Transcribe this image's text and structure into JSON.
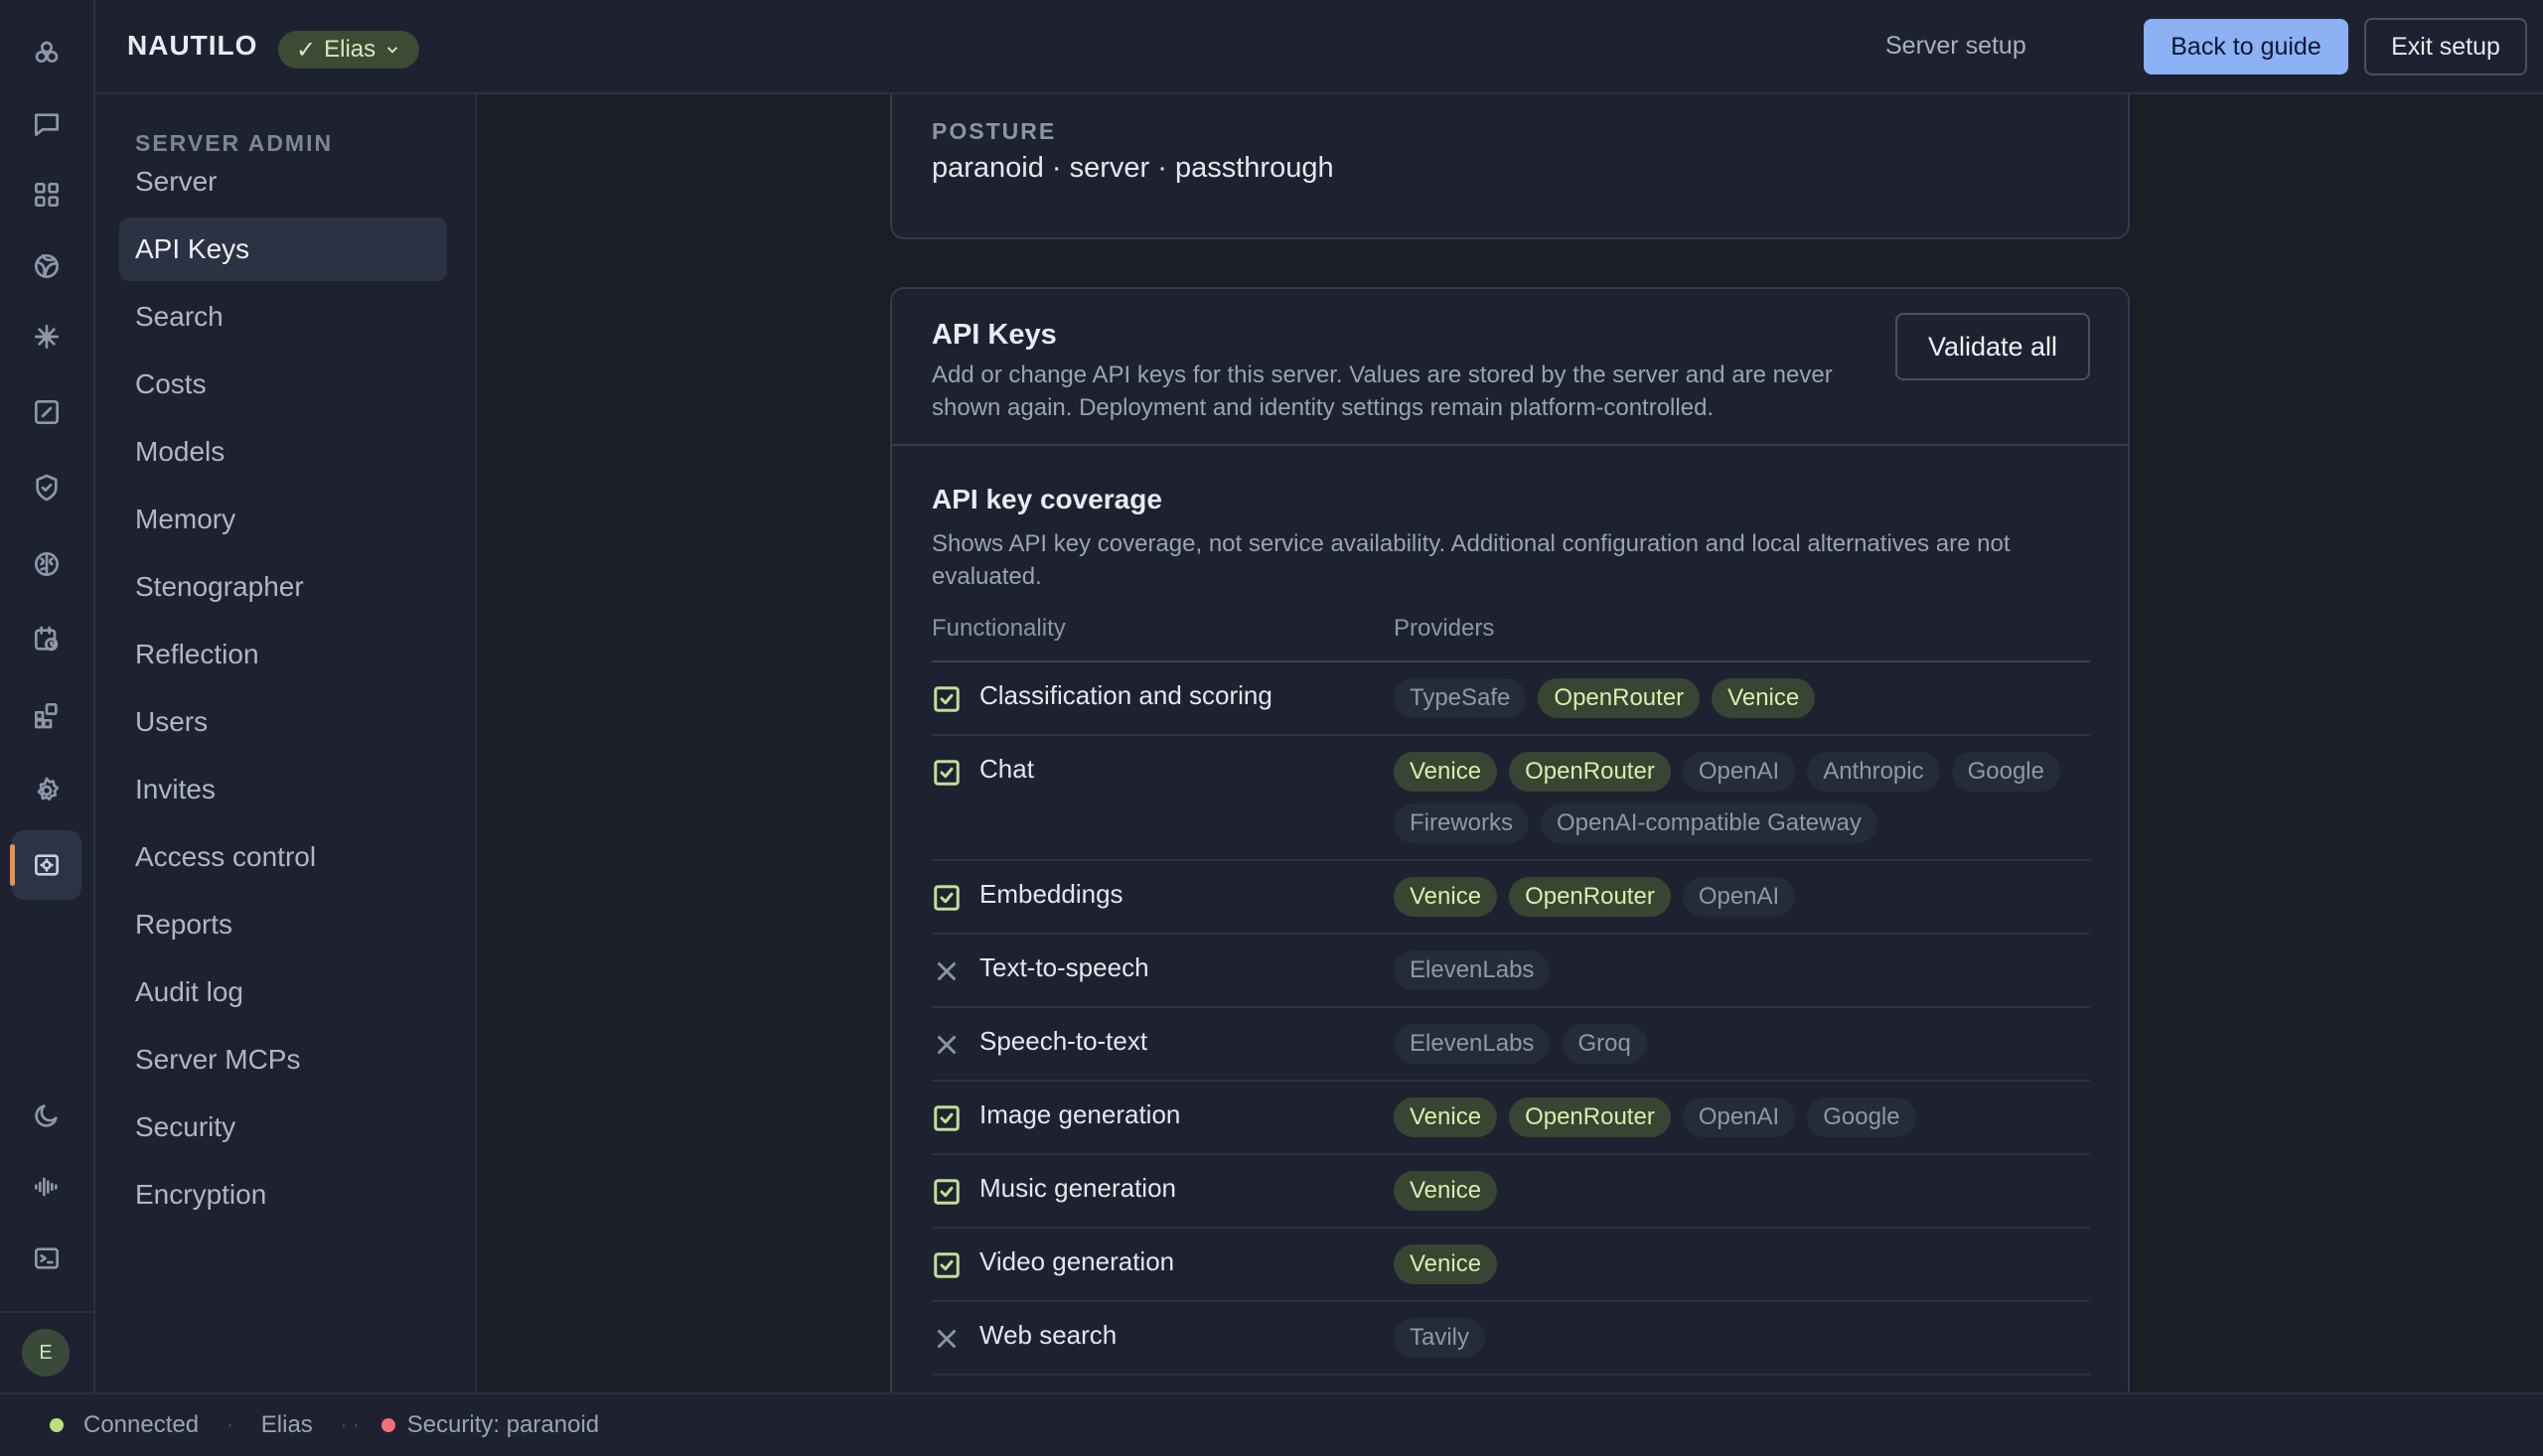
{
  "topbar": {
    "brand": "NAUTILO",
    "user": "Elias",
    "server_setup": "Server setup",
    "back_to_guide": "Back to guide",
    "exit_setup": "Exit setup"
  },
  "rail": {
    "icons": [
      "logo-icon",
      "chat-icon",
      "grid-icon",
      "globe-icon",
      "sparkle-icon",
      "edit-icon",
      "shield-icon",
      "brain-icon",
      "calendar-clock-icon",
      "apps-icon",
      "gear-icon",
      "server-admin-icon",
      "moon-icon",
      "audio-wave-icon",
      "terminal-icon"
    ],
    "avatar_initial": "E"
  },
  "sidebar": {
    "heading": "SERVER ADMIN",
    "items": [
      "Server",
      "API Keys",
      "Search",
      "Costs",
      "Models",
      "Memory",
      "Stenographer",
      "Reflection",
      "Users",
      "Invites",
      "Access control",
      "Reports",
      "Audit log",
      "Server MCPs",
      "Security",
      "Encryption"
    ],
    "active": "API Keys"
  },
  "posture": {
    "label": "POSTURE",
    "value": "paranoid · server · passthrough"
  },
  "api_keys": {
    "title": "API Keys",
    "description": "Add or change API keys for this server. Values are stored by the server and are never shown again. Deployment and identity settings remain platform-controlled.",
    "validate_all": "Validate all",
    "coverage_title": "API key coverage",
    "coverage_description": "Shows API key coverage, not service availability. Additional configuration and local alternatives are not evaluated.",
    "col_functionality": "Functionality",
    "col_providers": "Providers",
    "rows": [
      {
        "name": "Classification and scoring",
        "covered": true,
        "providers": [
          {
            "name": "TypeSafe",
            "on": false
          },
          {
            "name": "OpenRouter",
            "on": true
          },
          {
            "name": "Venice",
            "on": true
          }
        ]
      },
      {
        "name": "Chat",
        "covered": true,
        "providers": [
          {
            "name": "Venice",
            "on": true
          },
          {
            "name": "OpenRouter",
            "on": true
          },
          {
            "name": "OpenAI",
            "on": false
          },
          {
            "name": "Anthropic",
            "on": false
          },
          {
            "name": "Google",
            "on": false
          },
          {
            "name": "Fireworks",
            "on": false
          },
          {
            "name": "OpenAI-compatible Gateway",
            "on": false
          }
        ]
      },
      {
        "name": "Embeddings",
        "covered": true,
        "providers": [
          {
            "name": "Venice",
            "on": true
          },
          {
            "name": "OpenRouter",
            "on": true
          },
          {
            "name": "OpenAI",
            "on": false
          }
        ]
      },
      {
        "name": "Text-to-speech",
        "covered": false,
        "providers": [
          {
            "name": "ElevenLabs",
            "on": false
          }
        ]
      },
      {
        "name": "Speech-to-text",
        "covered": false,
        "providers": [
          {
            "name": "ElevenLabs",
            "on": false
          },
          {
            "name": "Groq",
            "on": false
          }
        ]
      },
      {
        "name": "Image generation",
        "covered": true,
        "providers": [
          {
            "name": "Venice",
            "on": true
          },
          {
            "name": "OpenRouter",
            "on": true
          },
          {
            "name": "OpenAI",
            "on": false
          },
          {
            "name": "Google",
            "on": false
          }
        ]
      },
      {
        "name": "Music generation",
        "covered": true,
        "providers": [
          {
            "name": "Venice",
            "on": true
          }
        ]
      },
      {
        "name": "Video generation",
        "covered": true,
        "providers": [
          {
            "name": "Venice",
            "on": true
          }
        ]
      },
      {
        "name": "Web search",
        "covered": false,
        "providers": [
          {
            "name": "Tavily",
            "on": false
          }
        ]
      }
    ]
  },
  "statusbar": {
    "connected": "Connected",
    "user": "Elias",
    "security": "Security: paranoid",
    "connected_color": "#b9e27a",
    "security_color": "#f0707a"
  }
}
